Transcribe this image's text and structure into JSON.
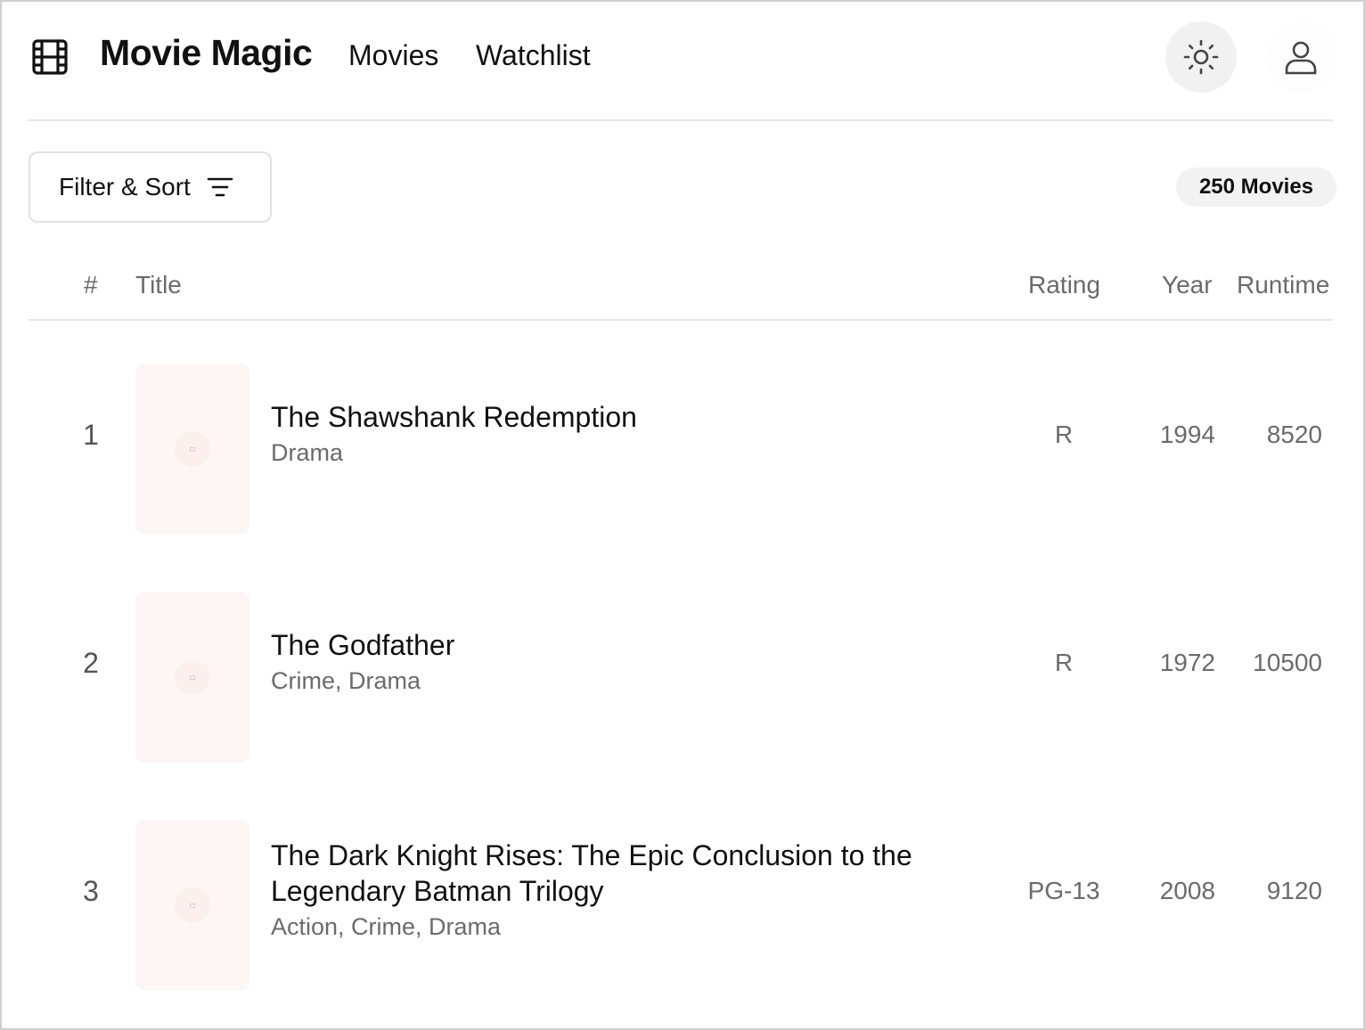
{
  "header": {
    "logo_icon": "film-icon",
    "brand": "Movie Magic",
    "nav": [
      {
        "label": "Movies"
      },
      {
        "label": "Watchlist"
      }
    ],
    "theme_icon": "sun-icon",
    "user_icon": "user-icon"
  },
  "toolbar": {
    "filter_label": "Filter & Sort",
    "filter_icon": "filter-lines-icon",
    "count_badge": "250 Movies"
  },
  "table": {
    "columns": {
      "rank": "#",
      "title": "Title",
      "rating": "Rating",
      "year": "Year",
      "runtime": "Runtime"
    },
    "rows": [
      {
        "rank": "1",
        "title": "The Shawshank Redemption",
        "genre": "Drama",
        "rating": "R",
        "year": "1994",
        "runtime": "8520"
      },
      {
        "rank": "2",
        "title": "The Godfather",
        "genre": "Crime, Drama",
        "rating": "R",
        "year": "1972",
        "runtime": "10500"
      },
      {
        "rank": "3",
        "title": "The Dark Knight Rises: The Epic Conclusion to the Legendary Batman Trilogy",
        "genre": "Action, Crime, Drama",
        "rating": "PG-13",
        "year": "2008",
        "runtime": "9120"
      }
    ]
  },
  "colors": {
    "text_primary": "#111111",
    "text_muted": "#6b6b6b",
    "divider": "#e6e6e6",
    "badge_bg": "#f2f2f2",
    "poster_placeholder": "#fcf6f5"
  }
}
